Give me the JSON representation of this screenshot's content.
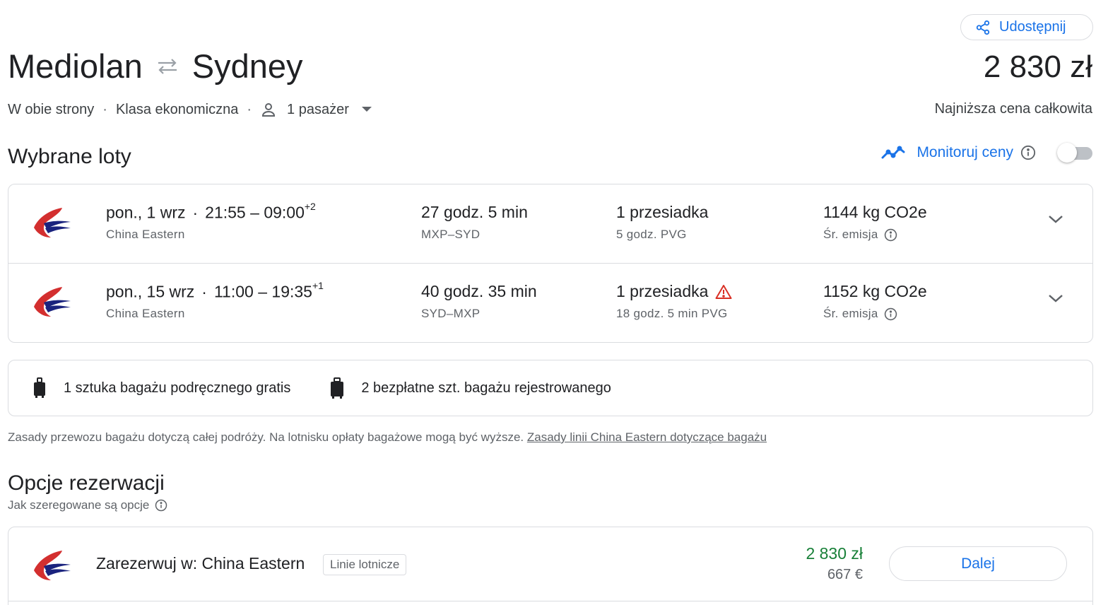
{
  "header": {
    "share_label": "Udostępnij",
    "origin": "Mediolan",
    "destination": "Sydney",
    "price": "2 830 zł",
    "price_caption": "Najniższa cena całkowita"
  },
  "trip_options": {
    "trip_type": "W obie strony",
    "cabin_class": "Klasa ekonomiczna",
    "passengers": "1 pasażer"
  },
  "selected": {
    "title": "Wybrane loty",
    "monitor_label": "Monitoruj ceny",
    "monitor_enabled": false
  },
  "flights": [
    {
      "date": "pon., 1 wrz",
      "dep": "21:55",
      "arr": "09:00",
      "day_offset": "+2",
      "airline": "China Eastern",
      "duration": "27 godz. 5 min",
      "route": "MXP–SYD",
      "stops": "1 przesiadka",
      "layover": "5 godz. PVG",
      "emissions": "1144 kg CO2e",
      "emissions_label": "Śr. emisja",
      "warning": false
    },
    {
      "date": "pon., 15 wrz",
      "dep": "11:00",
      "arr": "19:35",
      "day_offset": "+1",
      "airline": "China Eastern",
      "duration": "40 godz. 35 min",
      "route": "SYD–MXP",
      "stops": "1 przesiadka",
      "layover": "18 godz. 5 min PVG",
      "emissions": "1152 kg CO2e",
      "emissions_label": "Śr. emisja",
      "warning": true
    }
  ],
  "baggage": {
    "carry_on": "1 sztuka bagażu podręcznego gratis",
    "checked": "2 bezpłatne szt. bagażu rejestrowanego",
    "note": "Zasady przewozu bagażu dotyczą całej podróży. Na lotnisku opłaty bagażowe mogą być wyższe.",
    "link": "Zasady linii China Eastern dotyczące bagażu"
  },
  "booking": {
    "title": "Opcje rezerwacji",
    "sort_note": "Jak szeregowane są opcje",
    "option_label": "Zarezerwuj w: China Eastern",
    "badge": "Linie lotnicze",
    "price": "2 830 zł",
    "price_eur": "667 €",
    "next_label": "Dalej"
  },
  "colors": {
    "accent": "#1a73e8",
    "price_green": "#188038",
    "warning_red": "#d93025",
    "border": "#dadce0"
  },
  "icons": [
    "share-icon",
    "swap-arrows-icon",
    "person-icon",
    "caret-down-icon",
    "trend-line-icon",
    "info-icon",
    "china-eastern-logo-icon",
    "warning-icon",
    "chevron-down-icon",
    "carry-on-bag-icon",
    "checked-bag-icon"
  ]
}
